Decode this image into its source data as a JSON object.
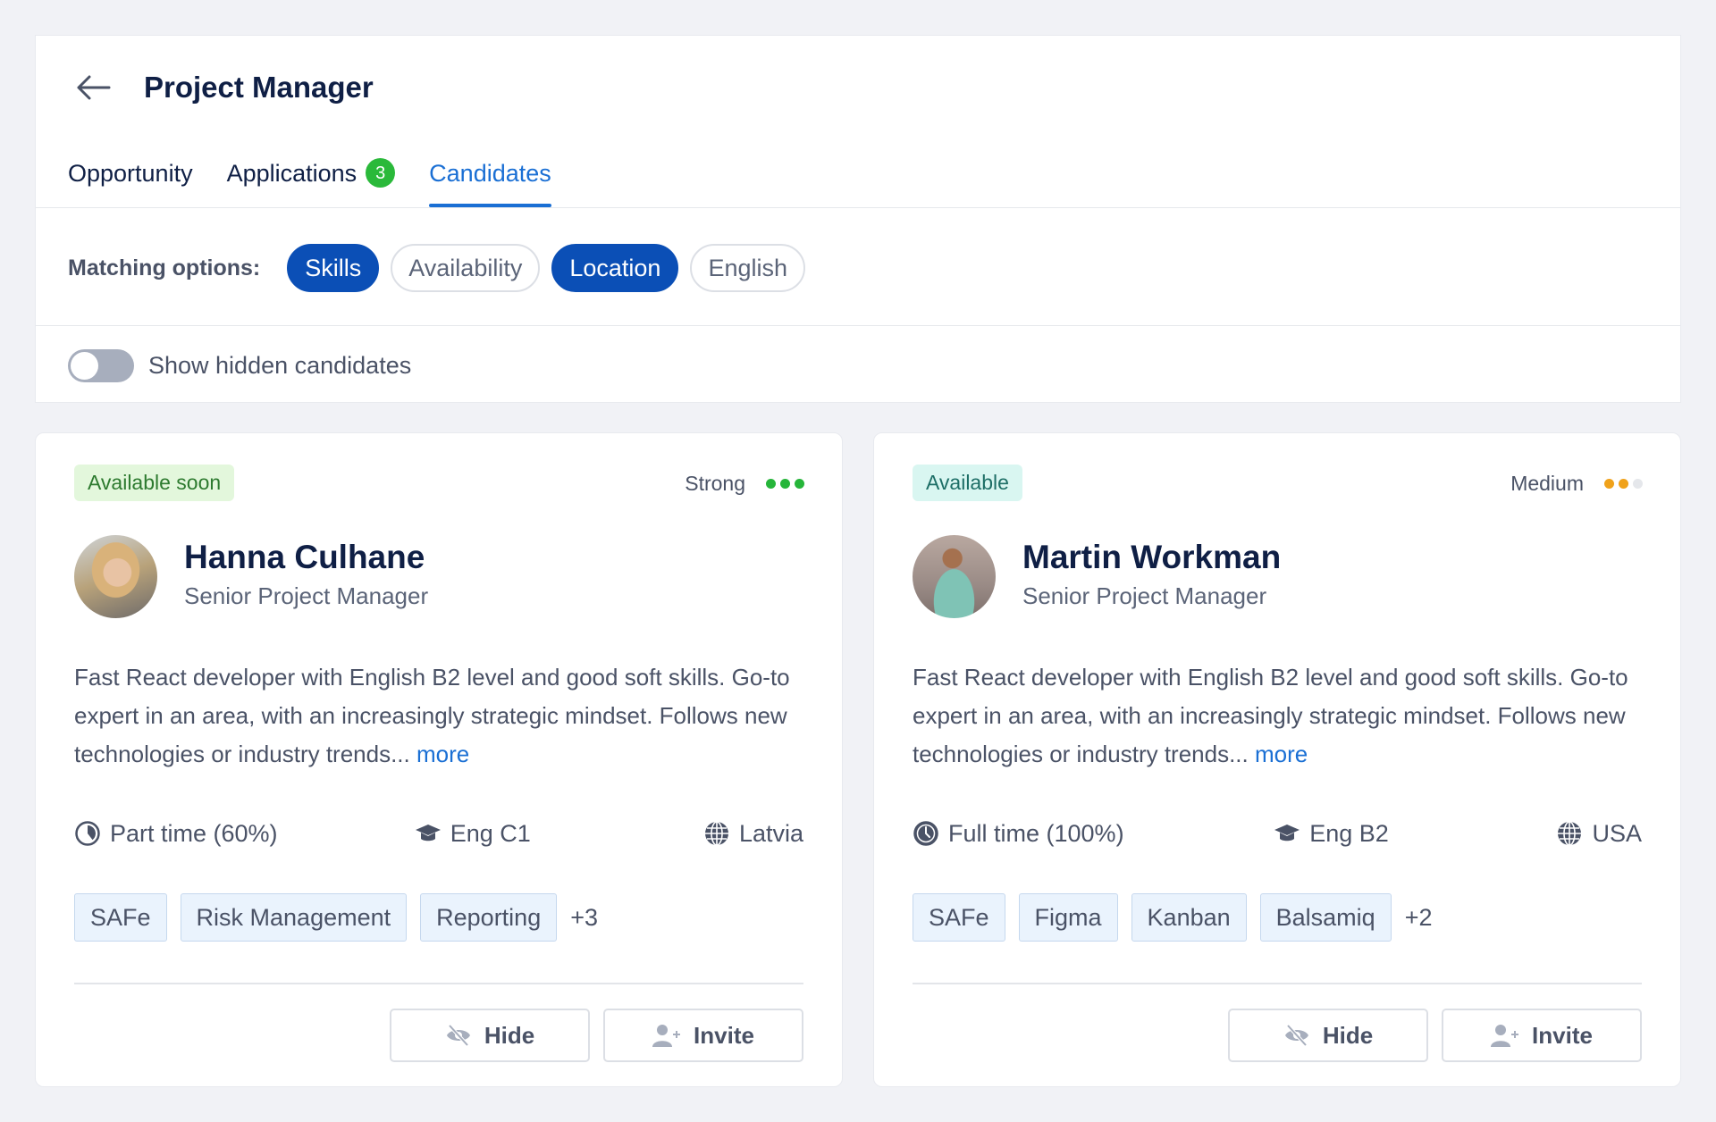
{
  "header": {
    "title": "Project Manager",
    "back_icon": "arrow-left-icon"
  },
  "tabs": [
    {
      "label": "Opportunity",
      "active": false
    },
    {
      "label": "Applications",
      "badge": "3",
      "active": false
    },
    {
      "label": "Candidates",
      "active": true
    }
  ],
  "matching": {
    "label": "Matching options:",
    "options": [
      {
        "label": "Skills",
        "selected": true
      },
      {
        "label": "Availability",
        "selected": false
      },
      {
        "label": "Location",
        "selected": true
      },
      {
        "label": "English",
        "selected": false
      }
    ]
  },
  "hidden_toggle": {
    "label": "Show hidden candidates",
    "on": false
  },
  "colors": {
    "accent": "#1a6fd4",
    "pill_selected": "#0b4fb6",
    "badge_green": "#2ab93a",
    "match_strong": "#26b53a",
    "match_medium": "#f0a21b"
  },
  "candidates": [
    {
      "availability": "Available soon",
      "match_label": "Strong",
      "match_level": 3,
      "match_max": 3,
      "name": "Hanna Culhane",
      "role": "Senior Project Manager",
      "description": "Fast React developer with English B2 level and good soft skills. Go-to expert in an area, with an increasingly strategic mindset. Follows new technologies or industry trends...",
      "more_label": "more",
      "employment": "Part time (60%)",
      "employment_icon": "clock-pie-icon",
      "english": "Eng C1",
      "english_icon": "graduation-cap-icon",
      "location": "Latvia",
      "location_icon": "globe-icon",
      "tags": [
        "SAFe",
        "Risk Management",
        "Reporting"
      ],
      "more_tags": "+3",
      "hide_label": "Hide",
      "invite_label": "Invite"
    },
    {
      "availability": "Available",
      "match_label": "Medium",
      "match_level": 2,
      "match_max": 3,
      "name": "Martin Workman",
      "role": "Senior Project Manager",
      "description": "Fast React developer with English B2 level and good soft skills. Go-to expert in an area, with an increasingly strategic mindset. Follows new technologies or industry trends...",
      "more_label": "more",
      "employment": "Full time (100%)",
      "employment_icon": "clock-icon",
      "english": "Eng B2",
      "english_icon": "graduation-cap-icon",
      "location": "USA",
      "location_icon": "globe-icon",
      "tags": [
        "SAFe",
        "Figma",
        "Kanban",
        "Balsamiq"
      ],
      "more_tags": "+2",
      "hide_label": "Hide",
      "invite_label": "Invite"
    }
  ]
}
